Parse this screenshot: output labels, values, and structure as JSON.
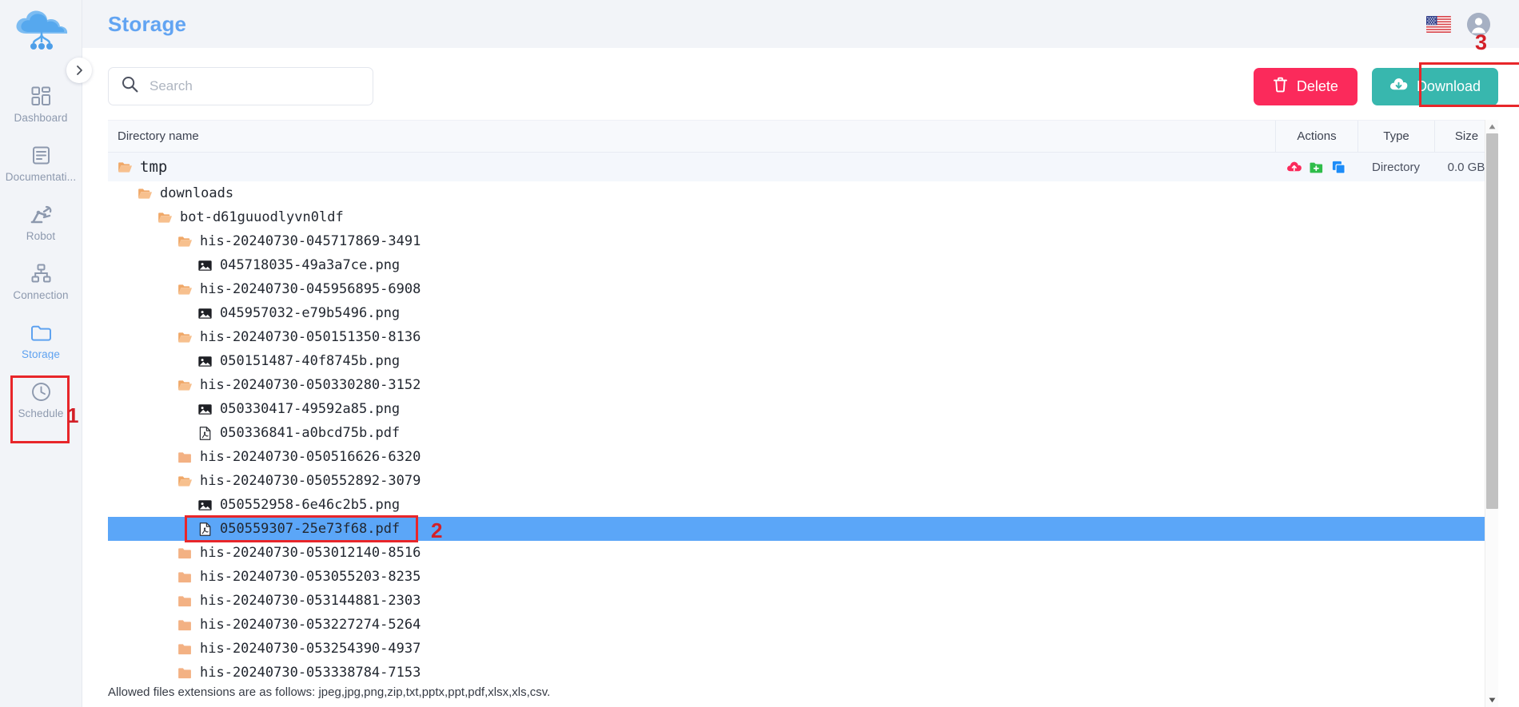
{
  "app": {
    "logo_icon": "cloud-network-logo"
  },
  "sidebar": {
    "collapse_icon": "chevron-right-icon",
    "items": [
      {
        "label": "Dashboard",
        "icon": "dashboard-grid-icon",
        "active": false
      },
      {
        "label": "Documentati...",
        "icon": "document-icon",
        "active": false
      },
      {
        "label": "Robot",
        "icon": "robot-arm-icon",
        "active": false
      },
      {
        "label": "Connection",
        "icon": "sitemap-icon",
        "active": false
      },
      {
        "label": "Storage",
        "icon": "folder-icon",
        "active": true
      },
      {
        "label": "Schedule",
        "icon": "clock-icon",
        "active": false
      }
    ]
  },
  "header": {
    "title": "Storage",
    "flag_icon": "us-flag-icon",
    "avatar_icon": "user-avatar-icon"
  },
  "toolbar": {
    "search": {
      "icon": "search-icon",
      "placeholder": "Search",
      "value": ""
    },
    "delete_label": "Delete",
    "delete_icon": "trash-icon",
    "delete_color": "#fb2a5b",
    "download_label": "Download",
    "download_icon": "cloud-download-icon",
    "download_color": "#38b7ae"
  },
  "table": {
    "columns": {
      "name": "Directory name",
      "actions": "Actions",
      "type": "Type",
      "size": "Size"
    },
    "row_actions": [
      {
        "icon": "cloud-upload-icon",
        "color": "#fb2a5b"
      },
      {
        "icon": "folder-add-icon",
        "color": "#2fbd4a"
      },
      {
        "icon": "copy-icon",
        "color": "#1d8cf8"
      }
    ],
    "rows": [
      {
        "name": "tmp",
        "indent": 0,
        "icon": "folder-open-icon",
        "type": "Directory",
        "size": "0.0 GB",
        "has_actions": true,
        "selected": false
      },
      {
        "name": "downloads",
        "indent": 1,
        "icon": "folder-open-icon",
        "type": "",
        "size": "",
        "has_actions": false,
        "selected": false
      },
      {
        "name": "bot-d61guuodlyvn0ldf",
        "indent": 2,
        "icon": "folder-open-icon",
        "type": "",
        "size": "",
        "has_actions": false,
        "selected": false
      },
      {
        "name": "his-20240730-045717869-3491",
        "indent": 3,
        "icon": "folder-open-icon",
        "type": "",
        "size": "",
        "has_actions": false,
        "selected": false
      },
      {
        "name": "045718035-49a3a7ce.png",
        "indent": 4,
        "icon": "image-file-icon",
        "type": "",
        "size": "",
        "has_actions": false,
        "selected": false
      },
      {
        "name": "his-20240730-045956895-6908",
        "indent": 3,
        "icon": "folder-open-icon",
        "type": "",
        "size": "",
        "has_actions": false,
        "selected": false
      },
      {
        "name": "045957032-e79b5496.png",
        "indent": 4,
        "icon": "image-file-icon",
        "type": "",
        "size": "",
        "has_actions": false,
        "selected": false
      },
      {
        "name": "his-20240730-050151350-8136",
        "indent": 3,
        "icon": "folder-open-icon",
        "type": "",
        "size": "",
        "has_actions": false,
        "selected": false
      },
      {
        "name": "050151487-40f8745b.png",
        "indent": 4,
        "icon": "image-file-icon",
        "type": "",
        "size": "",
        "has_actions": false,
        "selected": false
      },
      {
        "name": "his-20240730-050330280-3152",
        "indent": 3,
        "icon": "folder-open-icon",
        "type": "",
        "size": "",
        "has_actions": false,
        "selected": false
      },
      {
        "name": "050330417-49592a85.png",
        "indent": 4,
        "icon": "image-file-icon",
        "type": "",
        "size": "",
        "has_actions": false,
        "selected": false
      },
      {
        "name": "050336841-a0bcd75b.pdf",
        "indent": 4,
        "icon": "pdf-file-icon",
        "type": "",
        "size": "",
        "has_actions": false,
        "selected": false
      },
      {
        "name": "his-20240730-050516626-6320",
        "indent": 3,
        "icon": "folder-closed-icon",
        "type": "",
        "size": "",
        "has_actions": false,
        "selected": false
      },
      {
        "name": "his-20240730-050552892-3079",
        "indent": 3,
        "icon": "folder-open-icon",
        "type": "",
        "size": "",
        "has_actions": false,
        "selected": false
      },
      {
        "name": "050552958-6e46c2b5.png",
        "indent": 4,
        "icon": "image-file-icon",
        "type": "",
        "size": "",
        "has_actions": false,
        "selected": false
      },
      {
        "name": "050559307-25e73f68.pdf",
        "indent": 4,
        "icon": "pdf-file-icon",
        "type": "",
        "size": "",
        "has_actions": false,
        "selected": true
      },
      {
        "name": "his-20240730-053012140-8516",
        "indent": 3,
        "icon": "folder-closed-icon",
        "type": "",
        "size": "",
        "has_actions": false,
        "selected": false
      },
      {
        "name": "his-20240730-053055203-8235",
        "indent": 3,
        "icon": "folder-closed-icon",
        "type": "",
        "size": "",
        "has_actions": false,
        "selected": false
      },
      {
        "name": "his-20240730-053144881-2303",
        "indent": 3,
        "icon": "folder-closed-icon",
        "type": "",
        "size": "",
        "has_actions": false,
        "selected": false
      },
      {
        "name": "his-20240730-053227274-5264",
        "indent": 3,
        "icon": "folder-closed-icon",
        "type": "",
        "size": "",
        "has_actions": false,
        "selected": false
      },
      {
        "name": "his-20240730-053254390-4937",
        "indent": 3,
        "icon": "folder-closed-icon",
        "type": "",
        "size": "",
        "has_actions": false,
        "selected": false
      },
      {
        "name": "his-20240730-053338784-7153",
        "indent": 3,
        "icon": "folder-closed-icon",
        "type": "",
        "size": "",
        "has_actions": false,
        "selected": false
      }
    ]
  },
  "footer": {
    "note": "Allowed files extensions are as follows: jpeg,jpg,png,zip,txt,pptx,ppt,pdf,xlsx,xls,csv."
  },
  "annotations": {
    "color": "#e8262a",
    "marks": [
      {
        "label": "1",
        "target": "sidebar-item-storage"
      },
      {
        "label": "2",
        "target": "selected-file-row"
      },
      {
        "label": "3",
        "target": "download-button"
      }
    ]
  },
  "scrollbar": {
    "up_icon": "triangle-up-icon",
    "down_icon": "triangle-down-icon"
  }
}
